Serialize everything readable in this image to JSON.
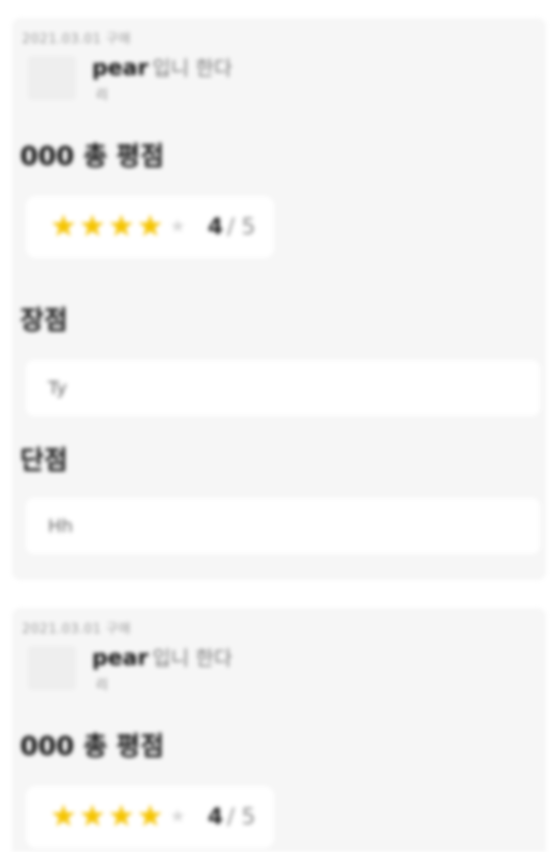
{
  "reviews": [
    {
      "meta": "2021.03.01 구매",
      "product_name": "pear",
      "product_suffix": "입니 한다",
      "product_sub": "리",
      "overall_title": "000 총 평점",
      "stars_filled": 4,
      "stars_total": 5,
      "rating_value": "4",
      "rating_unit": "/ 5",
      "pros_title": "장점",
      "pros_text": "Ty",
      "cons_title": "단점",
      "cons_text": "Hh"
    },
    {
      "meta": "2021.03.01 구매",
      "product_name": "pear",
      "product_suffix": "입니 한다",
      "product_sub": "리",
      "overall_title": "000 총 평점",
      "stars_filled": 4,
      "stars_total": 5,
      "rating_value": "4",
      "rating_unit": "/ 5"
    }
  ],
  "colors": {
    "card_bg": "#f6f6f6",
    "star_on": "#f5c400",
    "star_off": "#d6d6d6"
  },
  "icons": {
    "star": "star-icon",
    "thumbnail": "product-thumbnail"
  }
}
